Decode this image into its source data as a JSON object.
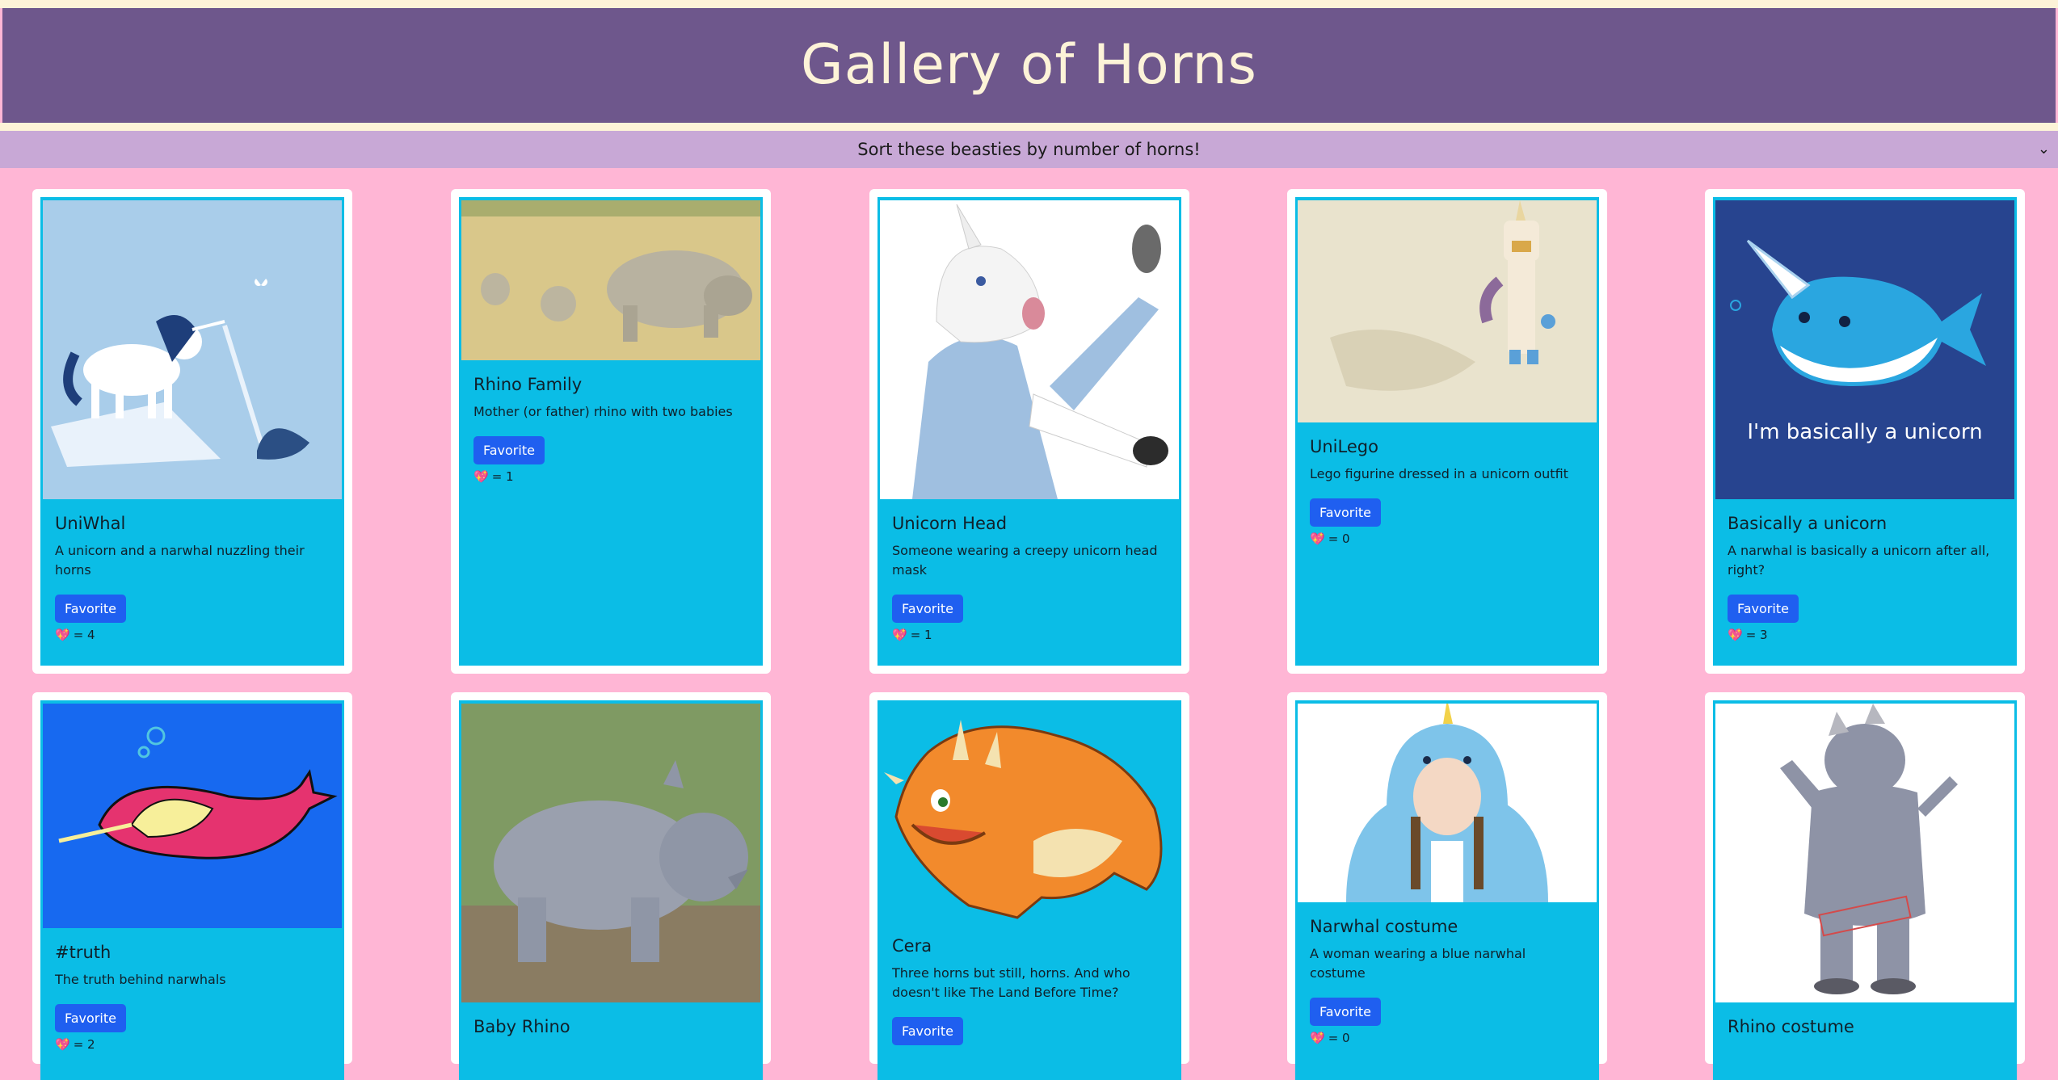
{
  "app_title": "Gallery of Horns",
  "sort": {
    "label": "Sort these beasties by number of horns!",
    "chevron_icon": "chevron-down-icon"
  },
  "favorite_label": "Favorite",
  "like_icon": "heart-icon",
  "cards": [
    {
      "title": "UniWhal",
      "desc": "A unicorn and a narwhal nuzzling their horns",
      "likes": "= 4",
      "bg": "#a9cdea"
    },
    {
      "title": "Rhino Family",
      "desc": "Mother (or father) rhino with two babies",
      "likes": "= 1",
      "bg": "#d9c78a"
    },
    {
      "title": "Unicorn Head",
      "desc": "Someone wearing a creepy unicorn head mask",
      "likes": "= 1",
      "bg": "#ffffff"
    },
    {
      "title": "UniLego",
      "desc": "Lego figurine dressed in a unicorn outfit",
      "likes": "= 0",
      "bg": "#e9e3cd"
    },
    {
      "title": "Basically a unicorn",
      "desc": "A narwhal is basically a unicorn after all, right?",
      "likes": "= 3",
      "bg": "#27448f",
      "caption": "I'm basically a unicorn"
    },
    {
      "title": "#truth",
      "desc": "The truth behind narwhals",
      "likes": "= 2",
      "bg": "#1769f0"
    },
    {
      "title": "Baby Rhino",
      "desc": "",
      "likes": "",
      "bg": "#7f9a63"
    },
    {
      "title": "Cera",
      "desc": "Three horns but still, horns. And who doesn't like The Land Before Time?",
      "likes": "",
      "bg": "#0bbde6"
    },
    {
      "title": "Narwhal costume",
      "desc": "A woman wearing a blue narwhal costume",
      "likes": "= 0",
      "bg": "#ffffff"
    },
    {
      "title": "Rhino costume",
      "desc": "",
      "likes": "",
      "bg": "#ffffff"
    }
  ]
}
